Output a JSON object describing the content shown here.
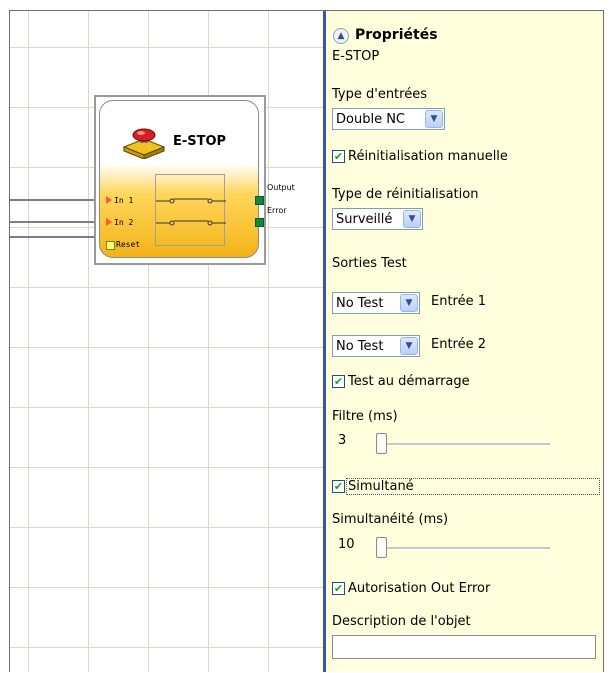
{
  "block": {
    "title": "E-STOP",
    "ports": {
      "in1": "In 1",
      "in2": "In 2",
      "reset": "Reset",
      "output": "Output",
      "error": "Error"
    }
  },
  "panel": {
    "title": "Propriétés",
    "object_name": "E-STOP",
    "input_type": {
      "label": "Type d'entrées",
      "value": "Double NC"
    },
    "manual_reset": {
      "label": "Réinitialisation manuelle",
      "checked": true
    },
    "reset_type": {
      "label": "Type de réinitialisation",
      "value": "Surveillé"
    },
    "test_outputs": {
      "label": "Sorties Test",
      "rows": [
        {
          "value": "No Test",
          "label": "Entrée 1"
        },
        {
          "value": "No Test",
          "label": "Entrée 2"
        }
      ]
    },
    "startup_test": {
      "label": "Test au démarrage",
      "checked": true
    },
    "filter": {
      "label": "Filtre (ms)",
      "value": "3"
    },
    "simultaneous": {
      "label": "Simultané",
      "checked": true
    },
    "simultaneity": {
      "label": "Simultanéité (ms)",
      "value": "10"
    },
    "out_error": {
      "label": "Autorisation Out Error",
      "checked": true
    },
    "description": {
      "label": "Description de l'objet",
      "value": ""
    }
  },
  "colors": {
    "accent_blue": "#3c55a3",
    "panel_bg": "#ffffdd",
    "block_orange": "#f3b318",
    "output_green": "#0f8a3a"
  }
}
